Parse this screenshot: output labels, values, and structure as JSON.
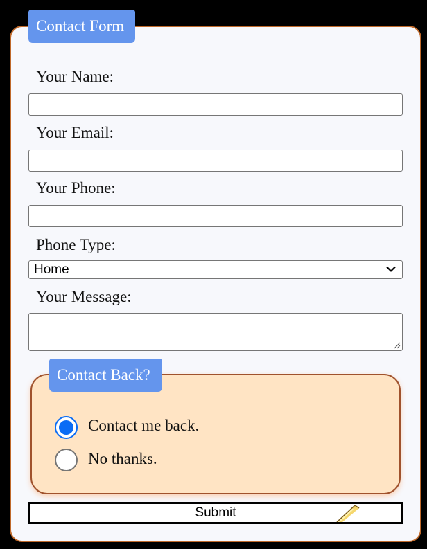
{
  "form": {
    "legend": "Contact Form",
    "fields": {
      "name_label": "Your Name:",
      "name_value": "",
      "email_label": "Your Email:",
      "email_value": "",
      "phone_label": "Your Phone:",
      "phone_value": "",
      "phone_type_label": "Phone Type:",
      "phone_type_selected": "Home",
      "message_label": "Your Message:",
      "message_value": ""
    },
    "contact_back": {
      "legend": "Contact Back?",
      "options": [
        {
          "label": "Contact me back.",
          "checked": true
        },
        {
          "label": "No thanks.",
          "checked": false
        }
      ]
    },
    "submit_label": "Submit"
  },
  "colors": {
    "page_background": "#000000",
    "form_background": "#f7f8fc",
    "form_border": "#c0692a",
    "legend_background": "#6495ed",
    "fieldset_background": "#ffe4c4",
    "fieldset_border": "#a0522d",
    "radio_accent": "#0a6cf5"
  },
  "icons": {
    "select_arrow": "chevron-down-icon",
    "textarea_grip": "resize-grip-icon",
    "submit_decoration": "pencil-icon"
  }
}
